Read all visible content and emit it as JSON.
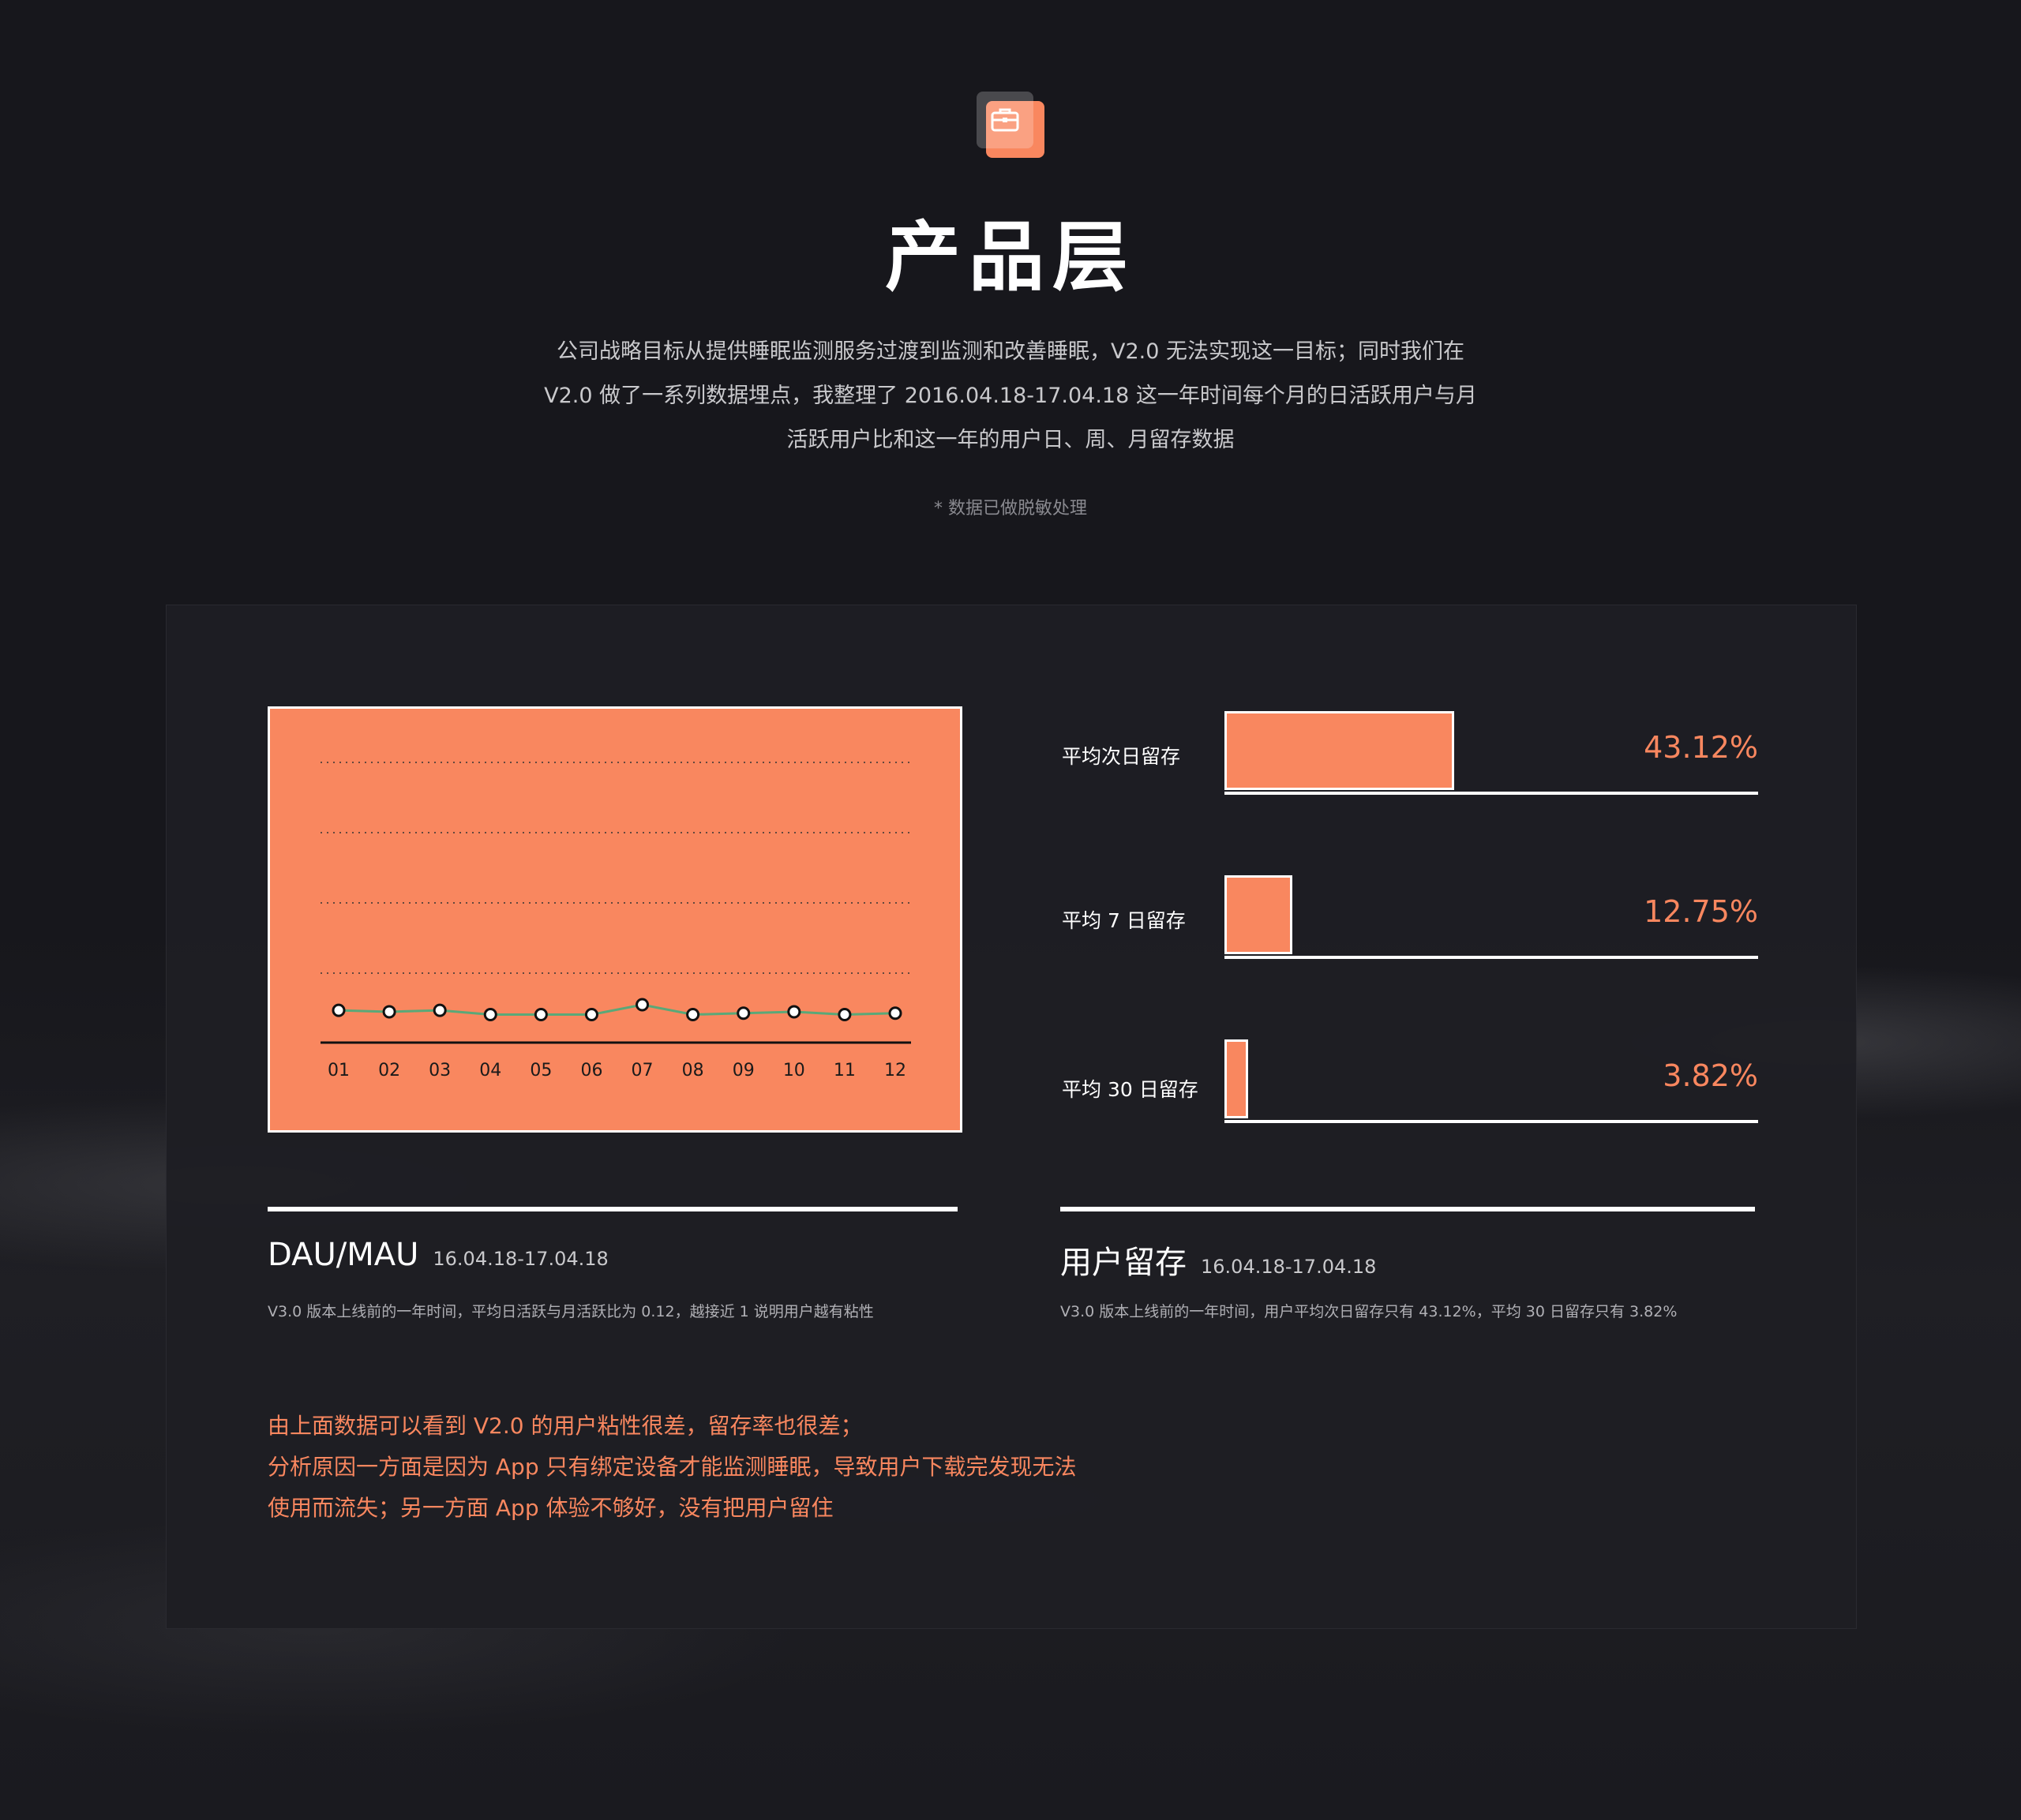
{
  "header": {
    "icon": "briefcase-icon",
    "title": "产品层",
    "intro_lines": [
      "公司战略目标从提供睡眠监测服务过渡到监测和改善睡眠，V2.0 无法实现这一目标；同时我们在",
      "V2.0 做了一系列数据埋点，我整理了 2016.04.18-17.04.18 这一年时间每个月的日活跃用户与月",
      "活跃用户比和这一年的用户日、周、月留存数据"
    ],
    "note": "* 数据已做脱敏处理"
  },
  "colors": {
    "accent": "#f9875f",
    "background": "#17171c",
    "line": "#5aa878"
  },
  "dau_section": {
    "title": "DAU/MAU",
    "date": "16.04.18-17.04.18",
    "desc": "V3.0 版本上线前的一年时间，平均日活跃与月活跃比为 0.12，越接近 1 说明用户越有粘性"
  },
  "retention_section": {
    "title": "用户留存",
    "date": "16.04.18-17.04.18",
    "desc": "V3.0 版本上线前的一年时间，用户平均次日留存只有 43.12%，平均 30 日留存只有 3.82%"
  },
  "conclusion_lines": [
    "由上面数据可以看到 V2.0 的用户粘性很差，留存率也很差；",
    "分析原因一方面是因为 App 只有绑定设备才能监测睡眠，导致用户下载完发现无法",
    "使用而流失；另一方面 App 体验不够好，没有把用户留住"
  ],
  "chart_data": [
    {
      "type": "line",
      "title": "DAU/MAU",
      "categories": [
        "01",
        "02",
        "03",
        "04",
        "05",
        "06",
        "07",
        "08",
        "09",
        "10",
        "11",
        "12"
      ],
      "values": [
        0.12,
        0.115,
        0.12,
        0.105,
        0.105,
        0.105,
        0.14,
        0.105,
        0.11,
        0.115,
        0.105,
        0.11
      ],
      "ylim": [
        0,
        1
      ],
      "grid": true,
      "xlabel": "",
      "ylabel": ""
    },
    {
      "type": "bar",
      "title": "用户留存",
      "orientation": "horizontal",
      "categories": [
        "平均次日留存",
        "平均 7 日留存",
        "平均 30 日留存"
      ],
      "values": [
        43.12,
        12.75,
        3.82
      ],
      "value_labels": [
        "43.12%",
        "12.75%",
        "3.82%"
      ],
      "xlim": [
        0,
        100
      ]
    }
  ]
}
